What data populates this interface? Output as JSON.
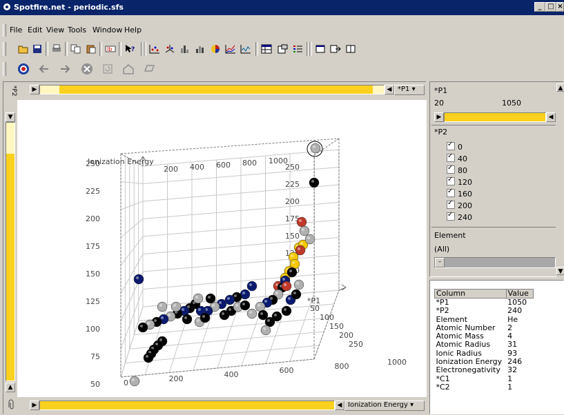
{
  "window": {
    "title": "Spotfire.net - periodic.sfs"
  },
  "menu": {
    "items": [
      "File",
      "Edit",
      "View",
      "Tools",
      "Window",
      "Help"
    ]
  },
  "toolbar": {
    "icons": [
      "open-icon",
      "save-icon",
      "print-icon",
      "copy-icon",
      "paste-icon",
      "swap-icon",
      "help-pointer-icon",
      "scatter-icon",
      "scatter3d-icon",
      "bar-icon",
      "bar3d-icon",
      "pie-icon",
      "line-icon",
      "profile-icon",
      "table-icon",
      "details-icon",
      "legend-icon",
      "new-window-icon",
      "export-icon",
      "layout-icon"
    ]
  },
  "navbar": {
    "icons": [
      "target-icon",
      "back-icon",
      "forward-icon",
      "stop-icon",
      "refresh-icon",
      "home-icon",
      "print-icon"
    ]
  },
  "plot": {
    "top_axis_selector": "*P1",
    "side_axis_selector": "*P2",
    "bottom_axis_selector": "Ionization Energy",
    "z_axis_label": "Ionization Energy",
    "x_axis_label": "*P1",
    "back_top_ticks": [
      "200",
      "400",
      "600",
      "800",
      "1000"
    ],
    "left_ticks": [
      "250",
      "225",
      "200",
      "175",
      "150",
      "125",
      "100",
      "75",
      "50"
    ],
    "right_ticks": [
      "250",
      "225",
      "200",
      "175",
      "150",
      "125",
      "100"
    ],
    "depth_ticks": [
      "50",
      "100",
      "150",
      "200",
      "250"
    ],
    "bottom_ticks": [
      "200",
      "400",
      "600",
      "800",
      "1000"
    ],
    "bottom_zero": "0"
  },
  "chart_data": {
    "type": "scatter",
    "title": "",
    "axes": {
      "x": "*P1",
      "y": "*P2",
      "z": "Ionization Energy"
    },
    "xlim": [
      0,
      1050
    ],
    "ylim": [
      0,
      250
    ],
    "zlim": [
      50,
      250
    ],
    "note_colors": {
      "black": "#000000",
      "navy": "#0a1a6e",
      "yellow": "#f5c800",
      "red": "#c0392b",
      "gray": "#b0b0b0"
    }
  },
  "filters": {
    "p1": {
      "label": "*P1",
      "min": "20",
      "max": "1050"
    },
    "p2": {
      "label": "*P2",
      "options": [
        "0",
        "40",
        "80",
        "120",
        "160",
        "200",
        "240"
      ]
    },
    "element": {
      "label": "Element",
      "value": "(All)"
    }
  },
  "details": {
    "header_column": "Column",
    "header_value": "Value",
    "rows": [
      {
        "column": "*P1",
        "value": "1050"
      },
      {
        "column": "*P2",
        "value": "240"
      },
      {
        "column": "Element",
        "value": "He"
      },
      {
        "column": "Atomic Number",
        "value": "2"
      },
      {
        "column": "Atomic Mass",
        "value": "4"
      },
      {
        "column": "Atomic Radius",
        "value": "31"
      },
      {
        "column": "Ionic Radius",
        "value": "93"
      },
      {
        "column": "Ionization Energy",
        "value": "246"
      },
      {
        "column": "Electronegativity",
        "value": "32"
      },
      {
        "column": "*C1",
        "value": "1"
      },
      {
        "column": "*C2",
        "value": "1"
      }
    ]
  }
}
